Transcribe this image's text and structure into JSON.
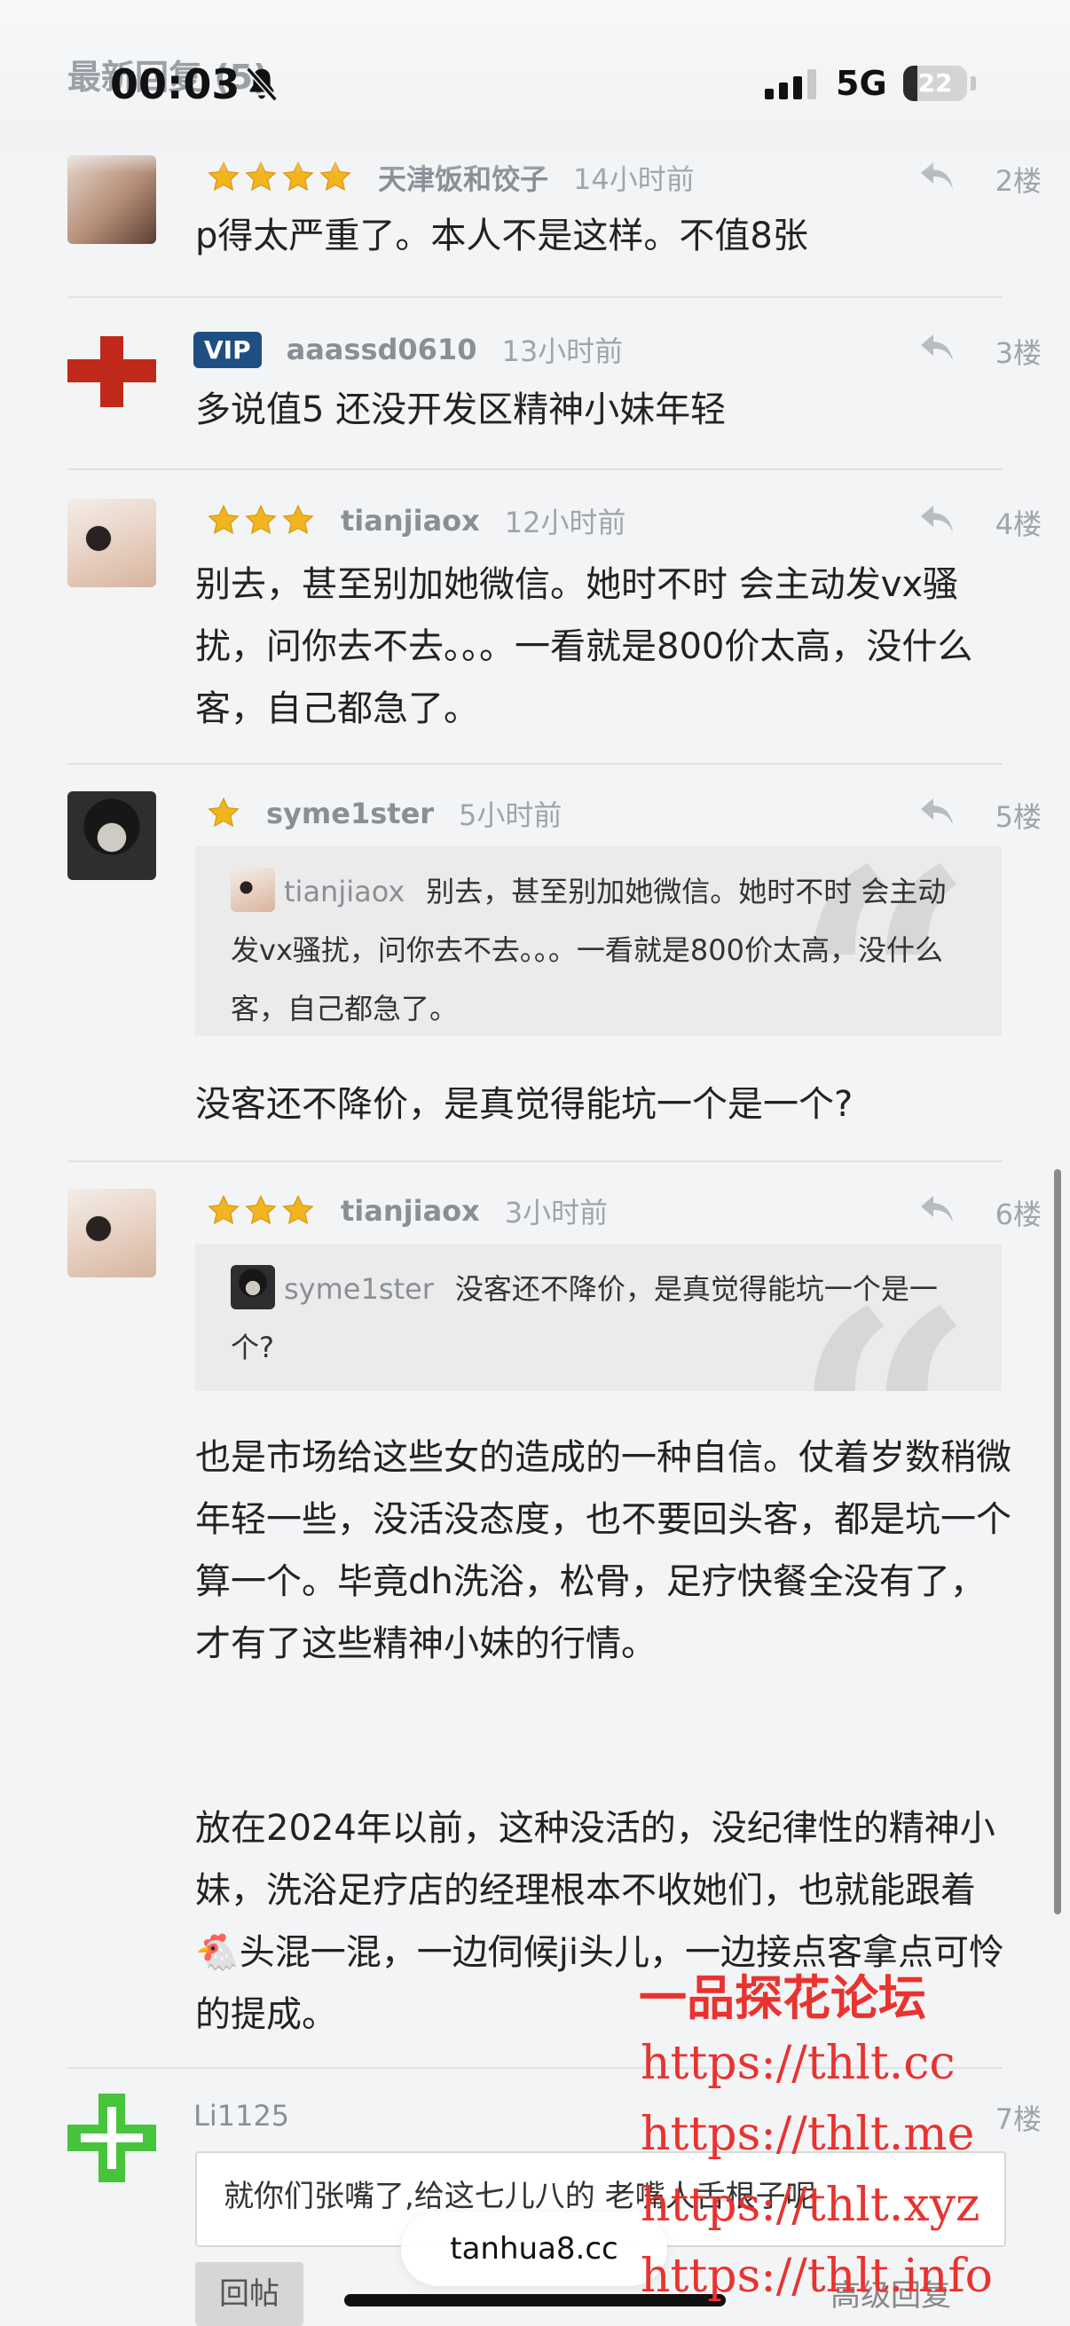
{
  "status_bar": {
    "time": "00:03",
    "network": "5G",
    "battery": "22",
    "battery_level": 0.22,
    "section_title": "最新回复 (5)"
  },
  "posts": [
    {
      "stars": 4,
      "username": "天津饭和饺子",
      "time_ago": "14小时前",
      "floor": "2楼",
      "text": "p得太严重了。本人不是这样。不值8张"
    },
    {
      "vip_badge": "VIP",
      "username": "aaassd0610",
      "time_ago": "13小时前",
      "floor": "3楼",
      "text": "多说值5 还没开发区精神小妹年轻"
    },
    {
      "stars": 3,
      "username": "tianjiaox",
      "time_ago": "12小时前",
      "floor": "4楼",
      "text": "别去，甚至别加她微信。她时不时 会主动发vx骚扰，问你去不去。。。一看就是800价太高，没什么客，自己都急了。"
    },
    {
      "stars": 1,
      "username": "syme1ster",
      "time_ago": "5小时前",
      "floor": "5楼",
      "quote_user": "tianjiaox",
      "quote_text": "别去，甚至别加她微信。她时不时 会主动发vx骚扰，问你去不去。。。一看就是800价太高，没什么客，自己都急了。",
      "text": "没客还不降价，是真觉得能坑一个是一个?"
    },
    {
      "stars": 3,
      "username": "tianjiaox",
      "time_ago": "3小时前",
      "floor": "6楼",
      "quote_user": "syme1ster",
      "quote_text": "没客还不降价，是真觉得能坑一个是一个?",
      "text_p1": "也是市场给这些女的造成的一种自信。仗着岁数稍微年轻一些，没活没态度，也不要回头客，都是坑一个算一个。毕竟dh洗浴，松骨，足疗快餐全没有了，才有了这些精神小妹的行情。",
      "text_p2": "放在2024年以前，这种没活的，没纪律性的精神小妹，洗浴足疗店的经理根本不收她们，也就能跟着🐔头混一混，一边伺候ji头儿，一边接点客拿点可怜的提成。"
    },
    {
      "username": "Li1125",
      "floor": "7楼"
    }
  ],
  "reply_box": {
    "text": "就你们张嘴了,给这七儿八的 老嘴人舌根子呢",
    "post_button": "回帖",
    "advanced": "高级回复"
  },
  "browser_url": "tanhua8.cc",
  "watermark": {
    "title": "一品探花论坛",
    "urls": [
      "https://thlt.cc",
      "https://thlt.me",
      "https://thlt.xyz",
      "https://thlt.info"
    ]
  },
  "colors": {
    "star": "#f2b51f",
    "vip": "#1f4e82",
    "watermark": "#e8332f",
    "cross_red": "#c0291a",
    "cross_green": "#46c43c"
  }
}
